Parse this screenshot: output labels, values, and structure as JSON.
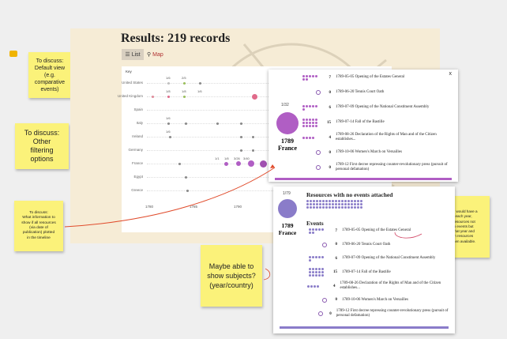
{
  "page": {
    "title": "Results:  219  records",
    "tab_list": "List",
    "tab_map": "Map",
    "key_label": "Key"
  },
  "stickies": {
    "default_view": "To discuss:\nDefault view\n(e.g.\ncomparative\nevents)",
    "filtering": "To discuss:\nOther\nfiltering\noptions",
    "info": "To discuss:\nWhat information to\nshow if all resources\n(via date of\npublication) plotted\nin the timeline",
    "subjects": "Maybe able to\nshow subjects?\n(year/country)",
    "card_note": "Each country would have a\n\"card\" for each year,\ndisplaying resources not\nattached to events but\npublished that year and\nevents with resources\nattached when available."
  },
  "chart": {
    "countries": [
      "United States",
      "United Kingdom",
      "Spain",
      "Italy",
      "Ireland",
      "Germany",
      "France",
      "Egypt",
      "Greece"
    ],
    "years": [
      "1780",
      "1785",
      "1790",
      "1795"
    ],
    "fracs": [
      {
        "row": 0,
        "col": 0,
        "t": "1/6"
      },
      {
        "row": 0,
        "col": 1,
        "t": "2/5"
      },
      {
        "row": 1,
        "col": 0,
        "t": "1/8"
      },
      {
        "row": 1,
        "col": 1,
        "t": "1/8"
      },
      {
        "row": 1,
        "col": 2,
        "t": "1/6"
      },
      {
        "row": 3,
        "col": 0,
        "t": "1/6"
      },
      {
        "row": 4,
        "col": 0,
        "t": "1/6"
      },
      {
        "row": 6,
        "col": 0,
        "t": "1/1"
      },
      {
        "row": 6,
        "col": 1,
        "t": "1/8"
      },
      {
        "row": 6,
        "col": 2,
        "t": "3/26"
      },
      {
        "row": 6,
        "col": 3,
        "t": "3/40"
      }
    ]
  },
  "popup": {
    "close": "x",
    "ratio": "1/32",
    "year": "1789",
    "country": "France",
    "events": [
      {
        "count": "7",
        "text": "1789-05-05 Opening of the Estates General"
      },
      {
        "count": "0",
        "text": "1789-06-20 Tennis Court Oath"
      },
      {
        "count": "6",
        "text": "1789-07-09 Opening of the National Constituent Assembly"
      },
      {
        "count": "15",
        "text": "1789-07-14 Fall of the Bastille"
      },
      {
        "count": "4",
        "text": "1789-08-26 Declaration of the Rights of Man and of the Citizen establishes..."
      },
      {
        "count": "0",
        "text": "1789-10-06 Women's March on Versailles"
      },
      {
        "count": "0",
        "text": "1789-12 First decree repressing counter-revolutionary press (pursuit of personal defamation)"
      }
    ]
  },
  "card2": {
    "ratio": "1/79",
    "year": "1789",
    "country": "France",
    "no_events_heading": "Resources with no events attached",
    "events_heading": "Events",
    "events": [
      {
        "count": "7",
        "text": "1789-05-05 Opening of the Estates General"
      },
      {
        "count": "0",
        "text": "1789-06-20 Tennis Court Oath"
      },
      {
        "count": "6",
        "text": "1789-07-09 Opening of the National Constituent Assembly"
      },
      {
        "count": "15",
        "text": "1789-07-14 Fall of the Bastille"
      },
      {
        "count": "4",
        "text": "1789-08-26 Declaration of the Rights of Man and of the Citizen establishes..."
      },
      {
        "count": "0",
        "text": "1789-10-06 Women's March on Versailles"
      },
      {
        "count": "0",
        "text": "1789-12 First decree repressing counter-revolutionary press (pursuit of personal defamation)"
      }
    ]
  },
  "colors": {
    "purple": "#b05ec4",
    "violet": "#8a7cc9",
    "pink": "#e06a8a",
    "sticky": "#fbf27a",
    "arrow": "#e04a2a"
  }
}
